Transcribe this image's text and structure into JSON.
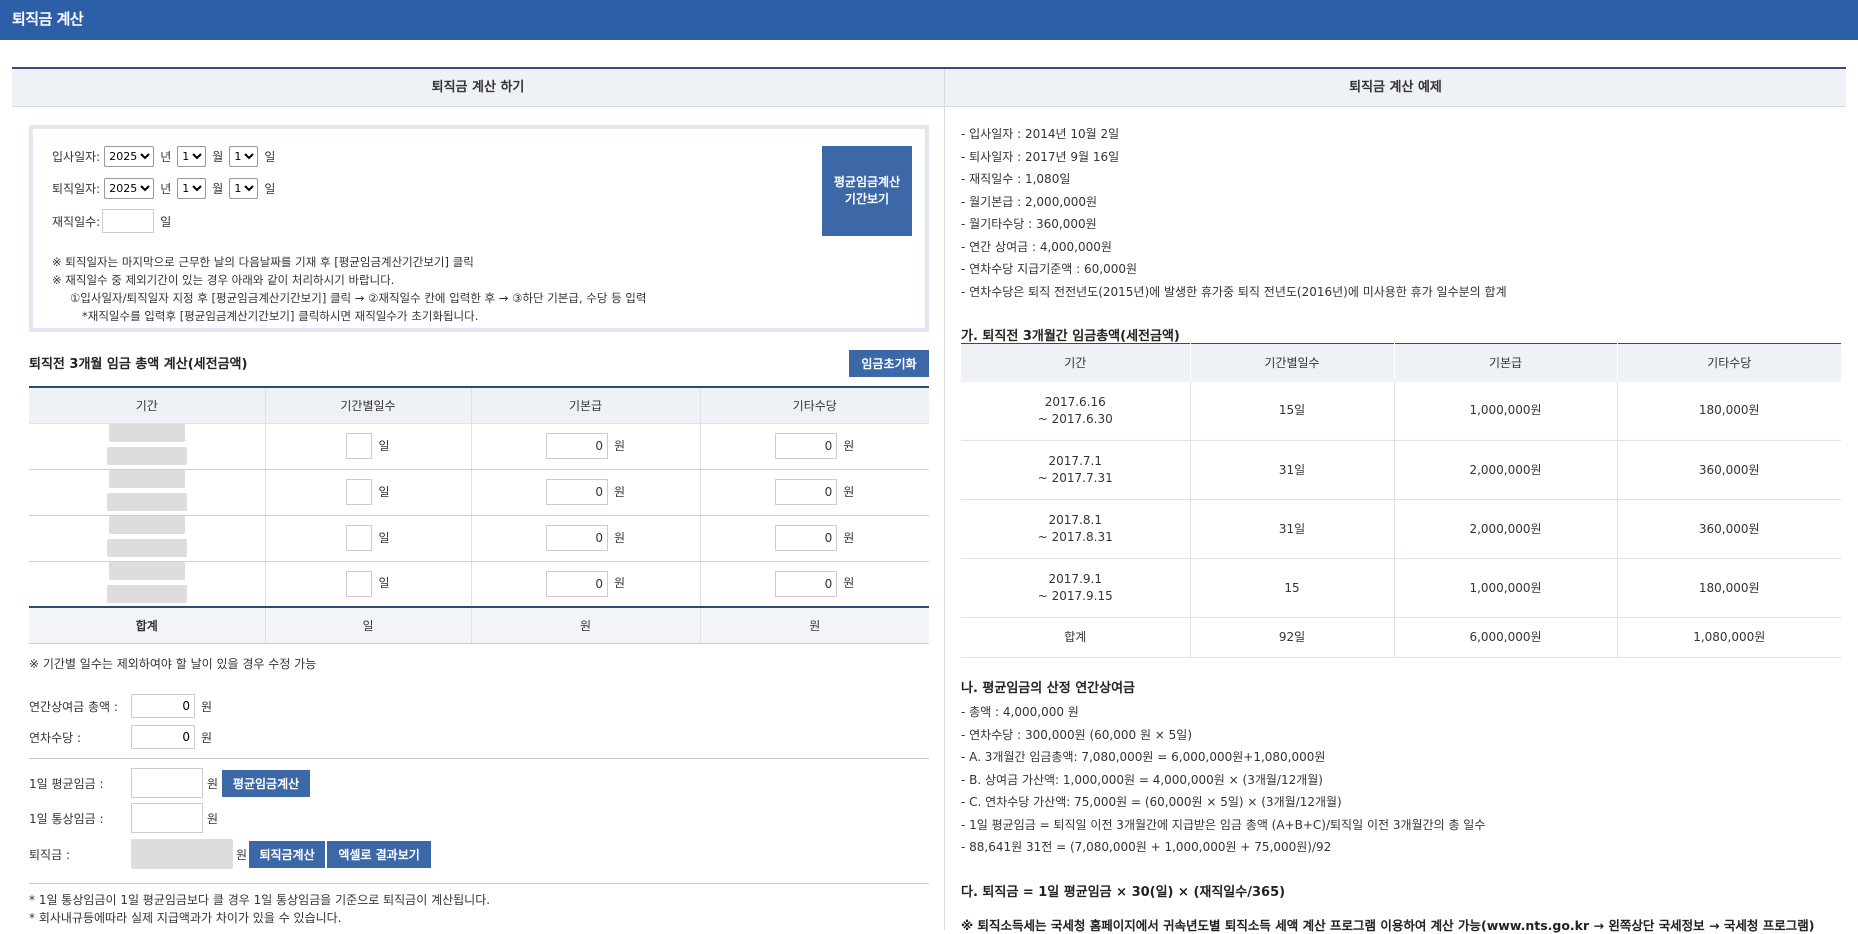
{
  "app": {
    "title": "퇴직금 계산"
  },
  "left": {
    "header": "퇴직금 계산 하기",
    "join": {
      "label": "입사일자:",
      "year": "2025",
      "year_unit": "년",
      "month": "1",
      "month_unit": "월",
      "day": "1",
      "day_unit": "일"
    },
    "leave": {
      "label": "퇴직일자:",
      "year": "2025",
      "year_unit": "년",
      "month": "1",
      "month_unit": "월",
      "day": "1",
      "day_unit": "일"
    },
    "tenure": {
      "label": "재직일수:",
      "unit": "일"
    },
    "period_button": "평균임금계산\n기간보기",
    "notes": [
      "※ 퇴직일자는 마지막으로 근무한 날의 다음날짜를 기재 후 [평균임금계산기간보기] 클릭",
      "※ 재직일수 중 제외기간이 있는 경우 아래와 같이 처리하시기 바랍니다.",
      "①입사일자/퇴직일자 지정 후 [평균임금계산기간보기] 클릭 → ②재직일수 칸에 입력한 후 → ③하단 기본급, 수당 등 입력",
      "*재직일수를 입력후 [평균임금계산기간보기] 클릭하시면 재직일수가 초기화됩니다."
    ],
    "wage_section": {
      "title": "퇴직전 3개월 임금 총액 계산(세전금액)",
      "reset_button": "임금초기화",
      "columns": [
        "기간",
        "기간별일수",
        "기본급",
        "기타수당"
      ],
      "rows": [
        {
          "base": "0",
          "other": "0"
        },
        {
          "base": "0",
          "other": "0"
        },
        {
          "base": "0",
          "other": "0"
        },
        {
          "base": "0",
          "other": "0"
        }
      ],
      "day_unit": "일",
      "won_unit": "원",
      "total": {
        "label": "합계",
        "days": "일",
        "base": "원",
        "other": "원"
      }
    },
    "editable_note": "※ 기간별 일수는 제외하여야 할 날이 있을 경우 수정 가능",
    "annual_bonus": {
      "label": "연간상여금 총액 :",
      "value": "0",
      "unit": "원"
    },
    "annual_leave": {
      "label": "연차수당 :",
      "value": "0",
      "unit": "원"
    },
    "avg_wage": {
      "label": "1일 평균임금 :",
      "unit": "원",
      "button": "평균임금계산"
    },
    "ordinary_wage": {
      "label": "1일 통상임금 :",
      "unit": "원"
    },
    "severance": {
      "label": "퇴직금 :",
      "unit": "원",
      "calc_button": "퇴직금계산",
      "excel_button": "엑셀로 결과보기"
    },
    "footnotes": [
      "* 1일 통상임금이 1일 평균임금보다 클 경우 1일 통상임금을 기준으로 퇴직금이 계산됩니다.",
      "* 회사내규등에따라 실제 지급액과가 차이가 있을 수 있습니다."
    ]
  },
  "right": {
    "header": "퇴직금 계산 예제",
    "facts": [
      "- 입사일자 : 2014년 10월 2일",
      "- 퇴사일자 : 2017년 9월 16일",
      "- 재직일수 : 1,080일",
      "- 월기본급 : 2,000,000원",
      "- 월기타수당 : 360,000원",
      "- 연간 상여금 : 4,000,000원",
      "- 연차수당 지급기준액 : 60,000원",
      "- 연차수당은 퇴직 전전년도(2015년)에 발생한 휴가중 퇴직 전년도(2016년)에 미사용한 휴가 일수분의 합계"
    ],
    "section_a": {
      "title": "가. 퇴직전 3개월간 임금총액(세전금액)",
      "columns": [
        "기간",
        "기간별일수",
        "기본급",
        "기타수당"
      ],
      "rows": [
        {
          "period1": "2017.6.16",
          "period2": "~ 2017.6.30",
          "days": "15일",
          "base": "1,000,000원",
          "other": "180,000원"
        },
        {
          "period1": "2017.7.1",
          "period2": "~ 2017.7.31",
          "days": "31일",
          "base": "2,000,000원",
          "other": "360,000원"
        },
        {
          "period1": "2017.8.1",
          "period2": "~ 2017.8.31",
          "days": "31일",
          "base": "2,000,000원",
          "other": "360,000원"
        },
        {
          "period1": "2017.9.1",
          "period2": "~ 2017.9.15",
          "days": "15",
          "base": "1,000,000원",
          "other": "180,000원"
        }
      ],
      "total": {
        "label": "합계",
        "days": "92일",
        "base": "6,000,000원",
        "other": "1,080,000원"
      }
    },
    "section_b": {
      "title": "나. 평균임금의 산정 연간상여금",
      "lines": [
        "- 총액 : 4,000,000 원",
        "- 연차수당 : 300,000원 (60,000 원 × 5일)",
        "- A. 3개월간 임금총액: 7,080,000원 = 6,000,000원+1,080,000원",
        "- B. 상여금 가산액: 1,000,000원 = 4,000,000원 × (3개월/12개월)",
        "- C. 연차수당 가산액: 75,000원 = (60,000원 × 5일) × (3개월/12개월)",
        "- 1일 평균임금 = 퇴직일 이전 3개월간에 지급받은 임금 총액 (A+B+C)/퇴직일 이전 3개월간의 총 일수",
        "- 88,641원 31전 = (7,080,000원 + 1,000,000원 + 75,000원)/92"
      ]
    },
    "section_c": {
      "title": "다. 퇴직금 = 1일 평균임금 × 30(일) × (재직일수/365)"
    },
    "tax_note": "※ 퇴직소득세는 국세청 홈페이지에서 귀속년도별 퇴직소득 세액 계산 프로그램 이용하여 계산 가능(www.nts.go.kr → 왼쪽상단 국세정보 → 국세청 프로그램)"
  }
}
